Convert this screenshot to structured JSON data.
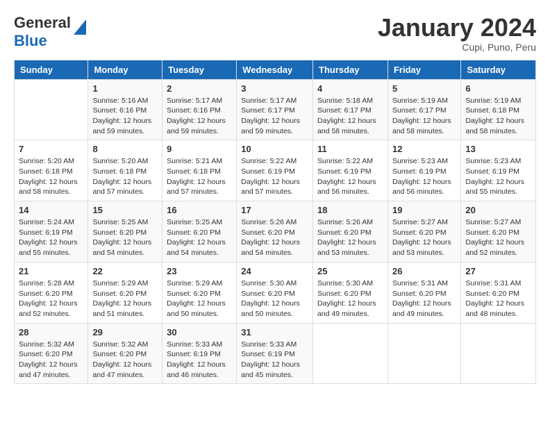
{
  "header": {
    "logo": {
      "general": "General",
      "blue": "Blue"
    },
    "title": "January 2024",
    "location": "Cupi, Puno, Peru"
  },
  "calendar": {
    "days_of_week": [
      "Sunday",
      "Monday",
      "Tuesday",
      "Wednesday",
      "Thursday",
      "Friday",
      "Saturday"
    ],
    "weeks": [
      [
        {
          "day": "",
          "sunrise": "",
          "sunset": "",
          "daylight": ""
        },
        {
          "day": "1",
          "sunrise": "Sunrise: 5:16 AM",
          "sunset": "Sunset: 6:16 PM",
          "daylight": "Daylight: 12 hours and 59 minutes."
        },
        {
          "day": "2",
          "sunrise": "Sunrise: 5:17 AM",
          "sunset": "Sunset: 6:16 PM",
          "daylight": "Daylight: 12 hours and 59 minutes."
        },
        {
          "day": "3",
          "sunrise": "Sunrise: 5:17 AM",
          "sunset": "Sunset: 6:17 PM",
          "daylight": "Daylight: 12 hours and 59 minutes."
        },
        {
          "day": "4",
          "sunrise": "Sunrise: 5:18 AM",
          "sunset": "Sunset: 6:17 PM",
          "daylight": "Daylight: 12 hours and 58 minutes."
        },
        {
          "day": "5",
          "sunrise": "Sunrise: 5:19 AM",
          "sunset": "Sunset: 6:17 PM",
          "daylight": "Daylight: 12 hours and 58 minutes."
        },
        {
          "day": "6",
          "sunrise": "Sunrise: 5:19 AM",
          "sunset": "Sunset: 6:18 PM",
          "daylight": "Daylight: 12 hours and 58 minutes."
        }
      ],
      [
        {
          "day": "7",
          "sunrise": "Sunrise: 5:20 AM",
          "sunset": "Sunset: 6:18 PM",
          "daylight": "Daylight: 12 hours and 58 minutes."
        },
        {
          "day": "8",
          "sunrise": "Sunrise: 5:20 AM",
          "sunset": "Sunset: 6:18 PM",
          "daylight": "Daylight: 12 hours and 57 minutes."
        },
        {
          "day": "9",
          "sunrise": "Sunrise: 5:21 AM",
          "sunset": "Sunset: 6:18 PM",
          "daylight": "Daylight: 12 hours and 57 minutes."
        },
        {
          "day": "10",
          "sunrise": "Sunrise: 5:22 AM",
          "sunset": "Sunset: 6:19 PM",
          "daylight": "Daylight: 12 hours and 57 minutes."
        },
        {
          "day": "11",
          "sunrise": "Sunrise: 5:22 AM",
          "sunset": "Sunset: 6:19 PM",
          "daylight": "Daylight: 12 hours and 56 minutes."
        },
        {
          "day": "12",
          "sunrise": "Sunrise: 5:23 AM",
          "sunset": "Sunset: 6:19 PM",
          "daylight": "Daylight: 12 hours and 56 minutes."
        },
        {
          "day": "13",
          "sunrise": "Sunrise: 5:23 AM",
          "sunset": "Sunset: 6:19 PM",
          "daylight": "Daylight: 12 hours and 55 minutes."
        }
      ],
      [
        {
          "day": "14",
          "sunrise": "Sunrise: 5:24 AM",
          "sunset": "Sunset: 6:19 PM",
          "daylight": "Daylight: 12 hours and 55 minutes."
        },
        {
          "day": "15",
          "sunrise": "Sunrise: 5:25 AM",
          "sunset": "Sunset: 6:20 PM",
          "daylight": "Daylight: 12 hours and 54 minutes."
        },
        {
          "day": "16",
          "sunrise": "Sunrise: 5:25 AM",
          "sunset": "Sunset: 6:20 PM",
          "daylight": "Daylight: 12 hours and 54 minutes."
        },
        {
          "day": "17",
          "sunrise": "Sunrise: 5:26 AM",
          "sunset": "Sunset: 6:20 PM",
          "daylight": "Daylight: 12 hours and 54 minutes."
        },
        {
          "day": "18",
          "sunrise": "Sunrise: 5:26 AM",
          "sunset": "Sunset: 6:20 PM",
          "daylight": "Daylight: 12 hours and 53 minutes."
        },
        {
          "day": "19",
          "sunrise": "Sunrise: 5:27 AM",
          "sunset": "Sunset: 6:20 PM",
          "daylight": "Daylight: 12 hours and 53 minutes."
        },
        {
          "day": "20",
          "sunrise": "Sunrise: 5:27 AM",
          "sunset": "Sunset: 6:20 PM",
          "daylight": "Daylight: 12 hours and 52 minutes."
        }
      ],
      [
        {
          "day": "21",
          "sunrise": "Sunrise: 5:28 AM",
          "sunset": "Sunset: 6:20 PM",
          "daylight": "Daylight: 12 hours and 52 minutes."
        },
        {
          "day": "22",
          "sunrise": "Sunrise: 5:29 AM",
          "sunset": "Sunset: 6:20 PM",
          "daylight": "Daylight: 12 hours and 51 minutes."
        },
        {
          "day": "23",
          "sunrise": "Sunrise: 5:29 AM",
          "sunset": "Sunset: 6:20 PM",
          "daylight": "Daylight: 12 hours and 50 minutes."
        },
        {
          "day": "24",
          "sunrise": "Sunrise: 5:30 AM",
          "sunset": "Sunset: 6:20 PM",
          "daylight": "Daylight: 12 hours and 50 minutes."
        },
        {
          "day": "25",
          "sunrise": "Sunrise: 5:30 AM",
          "sunset": "Sunset: 6:20 PM",
          "daylight": "Daylight: 12 hours and 49 minutes."
        },
        {
          "day": "26",
          "sunrise": "Sunrise: 5:31 AM",
          "sunset": "Sunset: 6:20 PM",
          "daylight": "Daylight: 12 hours and 49 minutes."
        },
        {
          "day": "27",
          "sunrise": "Sunrise: 5:31 AM",
          "sunset": "Sunset: 6:20 PM",
          "daylight": "Daylight: 12 hours and 48 minutes."
        }
      ],
      [
        {
          "day": "28",
          "sunrise": "Sunrise: 5:32 AM",
          "sunset": "Sunset: 6:20 PM",
          "daylight": "Daylight: 12 hours and 47 minutes."
        },
        {
          "day": "29",
          "sunrise": "Sunrise: 5:32 AM",
          "sunset": "Sunset: 6:20 PM",
          "daylight": "Daylight: 12 hours and 47 minutes."
        },
        {
          "day": "30",
          "sunrise": "Sunrise: 5:33 AM",
          "sunset": "Sunset: 6:19 PM",
          "daylight": "Daylight: 12 hours and 46 minutes."
        },
        {
          "day": "31",
          "sunrise": "Sunrise: 5:33 AM",
          "sunset": "Sunset: 6:19 PM",
          "daylight": "Daylight: 12 hours and 45 minutes."
        },
        {
          "day": "",
          "sunrise": "",
          "sunset": "",
          "daylight": ""
        },
        {
          "day": "",
          "sunrise": "",
          "sunset": "",
          "daylight": ""
        },
        {
          "day": "",
          "sunrise": "",
          "sunset": "",
          "daylight": ""
        }
      ]
    ]
  }
}
